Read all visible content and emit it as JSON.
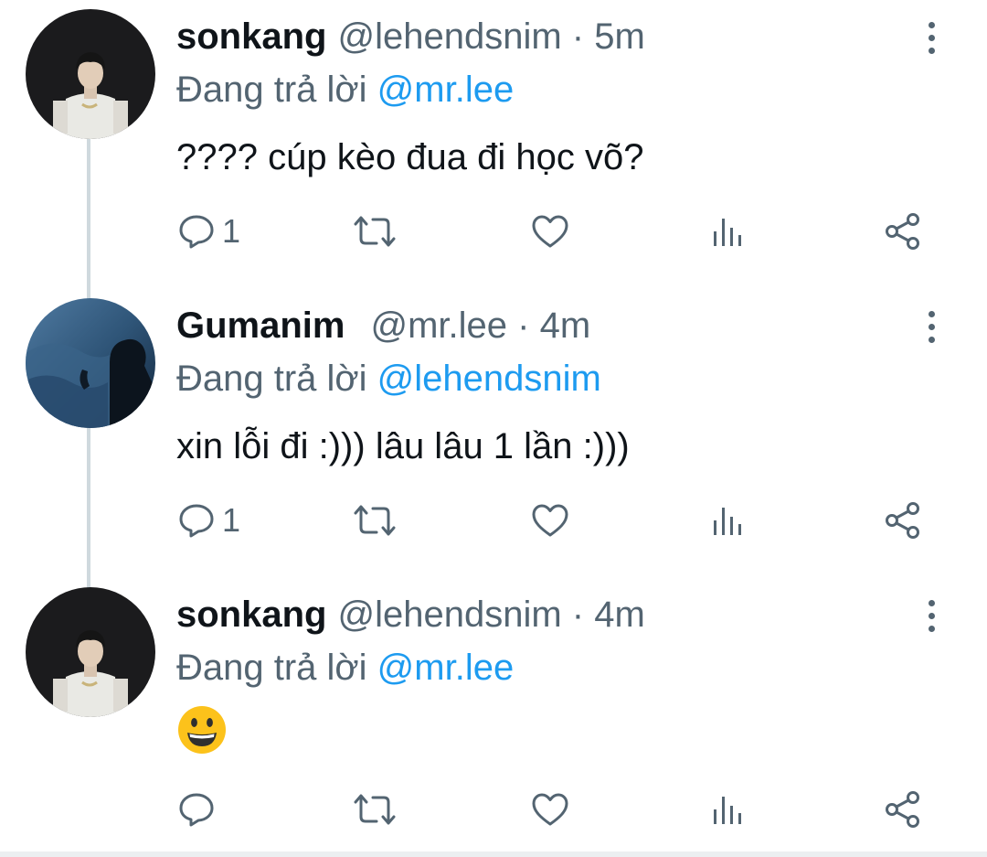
{
  "tweets": [
    {
      "name": "sonkang",
      "handle": "@lehendsnim",
      "separator": "·",
      "time": "5m",
      "replying_prefix": "Đang trả lời",
      "replying_to": "@mr.lee",
      "text": "???? cúp kèo đua đi học võ?",
      "reply_count": "1",
      "avatar": "person-white-tshirt"
    },
    {
      "name": "Gumanim",
      "handle": "@mr.lee",
      "separator": "·",
      "time": "4m",
      "replying_prefix": "Đang trả lời",
      "replying_to": "@lehendsnim",
      "text": "xin lỗi đi :))) lâu lâu 1 lần :)))",
      "reply_count": "1",
      "avatar": "silhouette-blue-water"
    },
    {
      "name": "sonkang",
      "handle": "@lehendsnim",
      "separator": "·",
      "time": "4m",
      "replying_prefix": "Đang trả lời",
      "replying_to": "@mr.lee",
      "text": "😀",
      "reply_count": "",
      "avatar": "person-white-tshirt"
    }
  ],
  "icons": {
    "reply": "reply-icon",
    "retweet": "retweet-icon",
    "like": "like-icon",
    "analytics": "analytics-icon",
    "share": "share-icon",
    "more": "more-icon"
  },
  "colors": {
    "link": "#1d9bf0",
    "secondary_text": "#536471",
    "thread_line": "#cfd9de"
  }
}
